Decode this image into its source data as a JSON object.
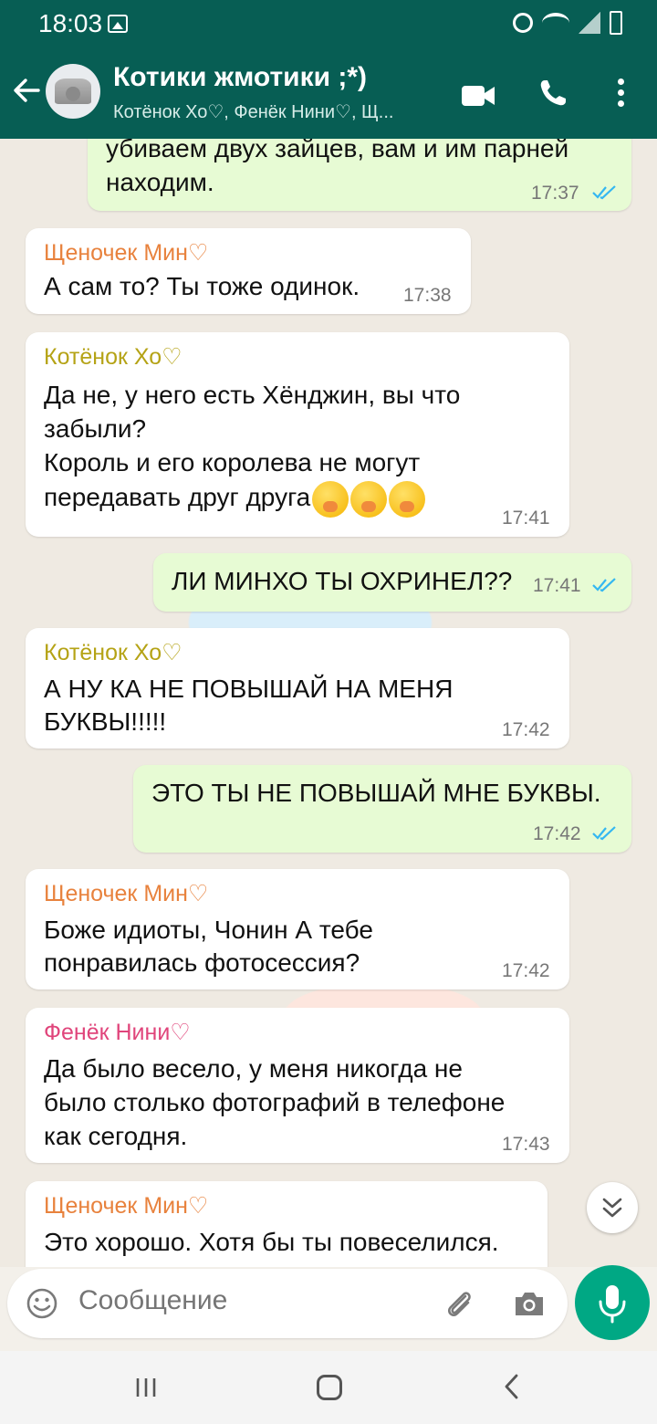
{
  "status_bar": {
    "time": "18:03"
  },
  "header": {
    "title": "Котики жмотики ;*)",
    "subtitle": "Котёнок Хо♡, Фенёк Нини♡, Щ..."
  },
  "colors": {
    "header": "#075e54",
    "outgoing": "#e7fbd4",
    "incoming": "#ffffff",
    "accent": "#00a884"
  },
  "messages": [
    {
      "direction": "out",
      "lines": [
        "убиваем двух зайцев, вам и им парней",
        "находим."
      ],
      "time": "17:37",
      "read": true
    },
    {
      "direction": "in",
      "sender": "Щеночек Мин♡",
      "sender_color": "#e8823d",
      "lines": [
        "А сам то? Ты тоже одинок."
      ],
      "time": "17:38"
    },
    {
      "direction": "in",
      "sender": "Котёнок Хо♡",
      "sender_color": "#b5a316",
      "lines": [
        "Да не, у него есть Хёнджин, вы что",
        "забыли?",
        "Король и его королева не могут",
        "передавать друг друга"
      ],
      "emoji": [
        "hand-over-mouth",
        "hand-over-mouth",
        "hand-over-mouth"
      ],
      "time": "17:41"
    },
    {
      "direction": "out",
      "lines": [
        "ЛИ МИНХО ТЫ ОХРИНЕЛ??"
      ],
      "time": "17:41",
      "read": true
    },
    {
      "direction": "in",
      "sender": "Котёнок Хо♡",
      "sender_color": "#b5a316",
      "lines": [
        "А НУ КА НЕ ПОВЫШАЙ НА МЕНЯ",
        "БУКВЫ!!!!!"
      ],
      "time": "17:42"
    },
    {
      "direction": "out",
      "lines": [
        "ЭТО ТЫ НЕ ПОВЫШАЙ МНЕ БУКВЫ."
      ],
      "time": "17:42",
      "read": true
    },
    {
      "direction": "in",
      "sender": "Щеночек Мин♡",
      "sender_color": "#e8823d",
      "lines": [
        "Боже идиоты, Чонин А тебе",
        "понравилась фотосессия?"
      ],
      "time": "17:42"
    },
    {
      "direction": "in",
      "sender": "Фенёк Нини♡",
      "sender_color": "#e0457b",
      "lines": [
        "Да было весело, у меня никогда не",
        "было столько фотографий в телефоне",
        "как сегодня."
      ],
      "time": "17:43"
    },
    {
      "direction": "in",
      "sender": "Щеночек Мин♡",
      "sender_color": "#e8823d",
      "lines": [
        "Это хорошо. Хотя бы ты повеселился."
      ],
      "time": ""
    }
  ],
  "input": {
    "placeholder": "Сообщение"
  },
  "icons": {
    "back": "arrow-left-icon",
    "video": "video-call-icon",
    "call": "phone-icon",
    "menu": "more-vert-icon",
    "emoji": "emoji-icon",
    "attach": "paperclip-icon",
    "camera": "camera-icon",
    "mic": "microphone-icon",
    "scroll": "double-chevron-down-icon"
  }
}
